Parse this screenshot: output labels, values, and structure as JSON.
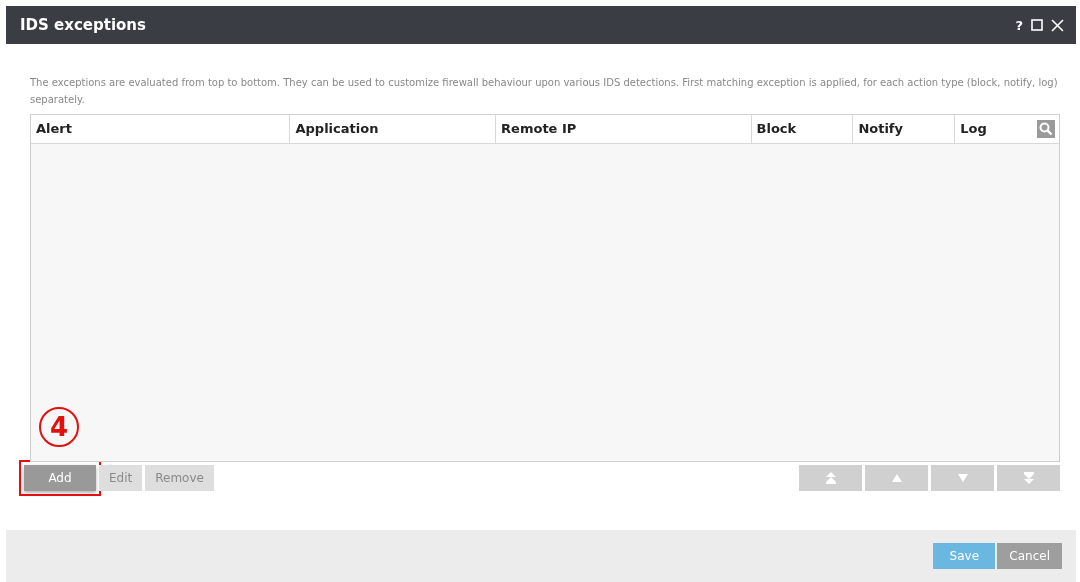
{
  "window": {
    "title": "IDS exceptions",
    "controls": [
      {
        "kind": "help",
        "label": "?"
      },
      {
        "kind": "maximize"
      },
      {
        "kind": "close"
      }
    ]
  },
  "description": "The exceptions are evaluated from top to bottom. They can be used to customize firewall behaviour upon various IDS detections. First matching exception is applied, for each action type (block, notify, log) separately.",
  "table": {
    "columns": [
      "Alert",
      "Application",
      "Remote IP",
      "Block",
      "Notify",
      "Log"
    ]
  },
  "annotation": {
    "label": "4"
  },
  "actions": [
    {
      "label": "Add",
      "disabled": false,
      "highlighted": true
    },
    {
      "label": "Edit",
      "disabled": true,
      "highlighted": false
    },
    {
      "label": "Remove",
      "disabled": true,
      "highlighted": false
    }
  ],
  "move_buttons": [
    {
      "kind": "top"
    },
    {
      "kind": "up"
    },
    {
      "kind": "down"
    },
    {
      "kind": "bottom"
    }
  ],
  "footer": [
    {
      "label": "Save",
      "kind": "primary"
    },
    {
      "label": "Cancel",
      "kind": "secondary"
    }
  ]
}
